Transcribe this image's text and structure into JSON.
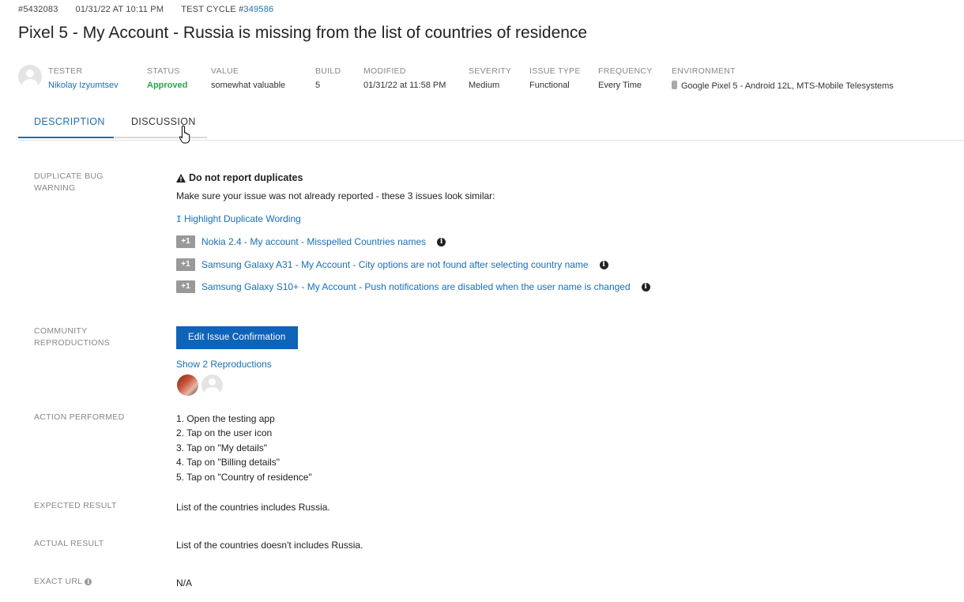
{
  "header": {
    "issue_id": "#5432083",
    "timestamp": "01/31/22 AT 10:11 PM",
    "test_cycle_label": "TEST CYCLE #",
    "test_cycle_id": "349586",
    "title": "Pixel 5 - My Account - Russia is missing from the list of countries of residence"
  },
  "fields": {
    "tester": {
      "label": "TESTER",
      "value": "Nikolay Izyumtsev"
    },
    "status": {
      "label": "STATUS",
      "value": "Approved",
      "color": "#27a74a"
    },
    "value": {
      "label": "VALUE",
      "value": "somewhat valuable"
    },
    "build": {
      "label": "BUILD",
      "value": "5"
    },
    "modified": {
      "label": "MODIFIED",
      "value": "01/31/22 at 11:58 PM"
    },
    "severity": {
      "label": "SEVERITY",
      "value": "Medium"
    },
    "issue_type": {
      "label": "ISSUE TYPE",
      "value": "Functional"
    },
    "frequency": {
      "label": "FREQUENCY",
      "value": "Every Time"
    },
    "environment": {
      "label": "ENVIRONMENT",
      "value": "Google Pixel 5 - Android 12L, MTS-Mobile Telesystems",
      "icon": "android-icon"
    }
  },
  "tabs": [
    {
      "label": "DESCRIPTION",
      "active": true
    },
    {
      "label": "DISCUSSION",
      "active": false
    }
  ],
  "duplicate_warning": {
    "label": "DUPLICATE BUG WARNING",
    "heading": "Do not report duplicates",
    "message": "Make sure your issue was not already reported - these 3 issues look similar:",
    "highlight_link": "Highlight Duplicate Wording",
    "plus_label": "+1",
    "items": [
      "Nokia 2.4 - My account - Misspelled Countries names",
      "Samsung Galaxy A31 - My Account - City options are not found after selecting country name",
      "Samsung Galaxy S10+ - My Account - Push notifications are disabled when the user name is changed"
    ]
  },
  "community": {
    "label": "COMMUNITY REPRODUCTIONS",
    "button": "Edit Issue Confirmation",
    "show_link": "Show 2 Reproductions"
  },
  "action_performed": {
    "label": "ACTION PERFORMED",
    "steps": [
      "1. Open the testing app",
      "2. Tap on the user icon",
      "3. Tap on \"My details\"",
      "4. Tap on \"Billing details\"",
      "5. Tap on \"Country of residence\""
    ]
  },
  "expected_result": {
    "label": "EXPECTED RESULT",
    "value": "List of the countries includes Russia."
  },
  "actual_result": {
    "label": "ACTUAL RESULT",
    "value": "List of the countries doesn't includes Russia."
  },
  "exact_url": {
    "label": "EXACT URL",
    "value": "N/A"
  },
  "colors": {
    "accent": "#1a6fb5",
    "button": "#0f63b8",
    "approved": "#27a74a"
  }
}
